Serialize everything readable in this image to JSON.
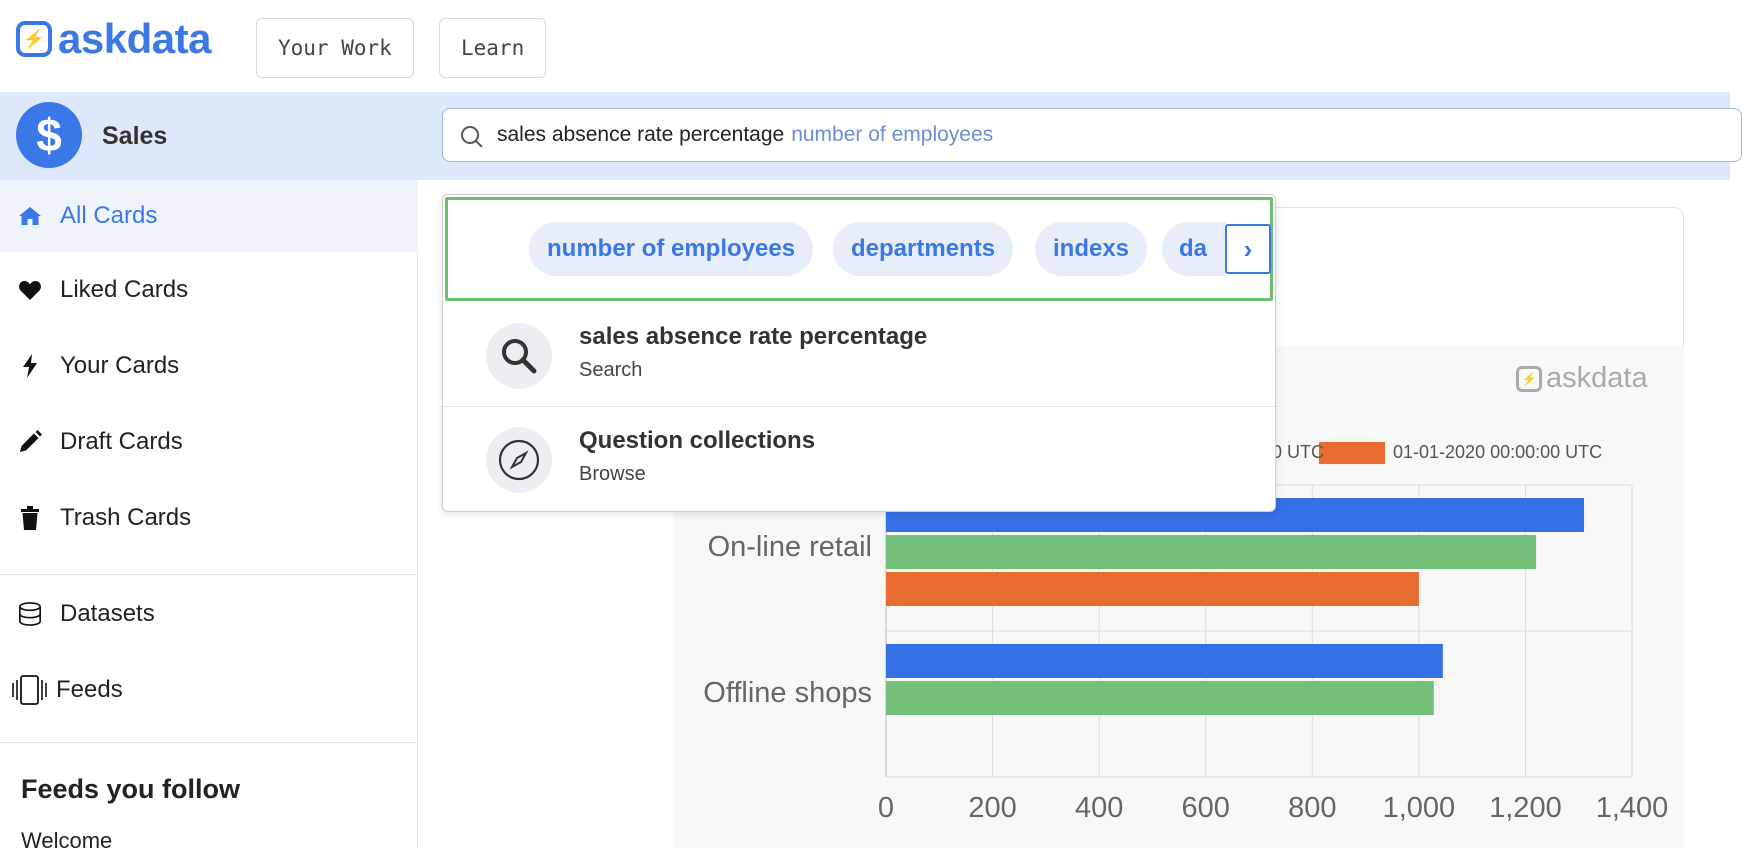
{
  "header": {
    "logo_text": "askdata",
    "nav": [
      {
        "label": "Your Work"
      },
      {
        "label": "Learn"
      }
    ]
  },
  "workspace": {
    "name": "Sales",
    "avatar_symbol": "$",
    "accent_color": "#3a78e8"
  },
  "search": {
    "typed_text": "sales absence rate percentage",
    "suggestion_text": "number of employees"
  },
  "suggestions": {
    "chips": [
      "number of employees",
      "departments",
      "indexs",
      "da"
    ],
    "results": [
      {
        "title": "sales absence rate percentage",
        "subtitle": "Search",
        "icon": "magnifier-icon"
      },
      {
        "title": "Question collections",
        "subtitle": "Browse",
        "icon": "compass-icon"
      }
    ]
  },
  "sidebar": {
    "items": [
      {
        "label": "All Cards",
        "icon": "home-icon",
        "active": true
      },
      {
        "label": "Liked Cards",
        "icon": "heart-icon"
      },
      {
        "label": "Your Cards",
        "icon": "bolt-icon"
      },
      {
        "label": "Draft Cards",
        "icon": "pencil-icon"
      },
      {
        "label": "Trash Cards",
        "icon": "trash-icon"
      },
      {
        "label": "Datasets",
        "icon": "database-icon"
      },
      {
        "label": "Feeds",
        "icon": "feeds-icon"
      }
    ],
    "follow_title": "Feeds you follow",
    "follow_items": [
      "Welcome"
    ]
  },
  "card": {
    "watermark": "askdata"
  },
  "chart_data": {
    "type": "bar",
    "orientation": "horizontal",
    "categories": [
      "On-line retail",
      "Offline shops"
    ],
    "series": [
      {
        "name": "",
        "color": "#3570e6",
        "values": [
          1310,
          1045
        ]
      },
      {
        "name": "",
        "color": "#72c07a",
        "values": [
          1220,
          1028
        ]
      },
      {
        "name": "01-01-2020 00:00:00 UTC",
        "color": "#e96c30",
        "values": [
          1000,
          null
        ]
      }
    ],
    "legend_partial_text": "0 UTC",
    "xlim": [
      0,
      1400
    ],
    "xticks": [
      "0",
      "200",
      "400",
      "600",
      "800",
      "1,000",
      "1,200",
      "1,400"
    ],
    "grid": true,
    "legend_position": "top"
  }
}
